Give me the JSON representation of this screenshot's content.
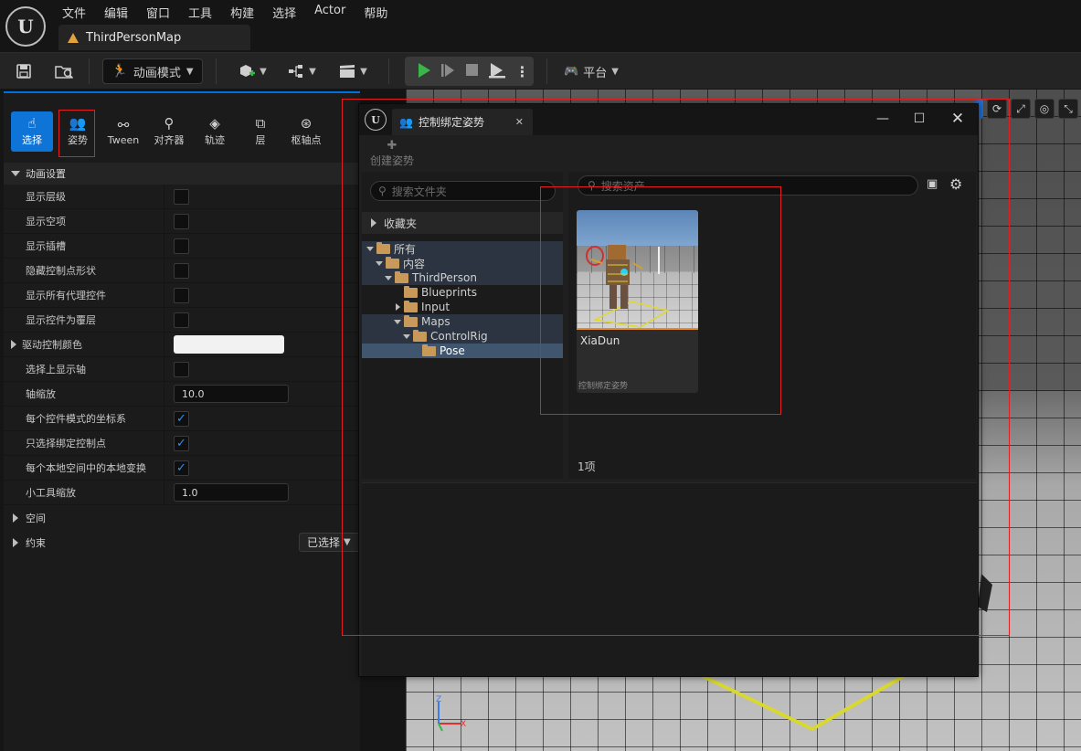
{
  "app": {
    "logo": "U",
    "menu": [
      "文件",
      "编辑",
      "窗口",
      "工具",
      "构建",
      "选择",
      "Actor",
      "帮助"
    ],
    "map_tab": "ThirdPersonMap"
  },
  "toolbar": {
    "mode_label": "动画模式",
    "platform_label": "平台"
  },
  "anim_tools": [
    {
      "label": "选择",
      "icon": "select-icon",
      "active": true
    },
    {
      "label": "姿势",
      "icon": "pose-icon",
      "active": false,
      "highlighted": true
    },
    {
      "label": "Tween",
      "icon": "tween-icon",
      "active": false
    },
    {
      "label": "对齐器",
      "icon": "snapper-icon",
      "active": false
    },
    {
      "label": "轨迹",
      "icon": "trails-icon",
      "active": false
    },
    {
      "label": "层",
      "icon": "layers-icon",
      "active": false
    },
    {
      "label": "枢轴点",
      "icon": "pivot-icon",
      "active": false
    }
  ],
  "settings": {
    "section_title": "动画设置",
    "rows": [
      {
        "label": "显示层级",
        "type": "checkbox",
        "checked": false
      },
      {
        "label": "显示空项",
        "type": "checkbox",
        "checked": false
      },
      {
        "label": "显示插槽",
        "type": "checkbox",
        "checked": false
      },
      {
        "label": "隐藏控制点形状",
        "type": "checkbox",
        "checked": false
      },
      {
        "label": "显示所有代理控件",
        "type": "checkbox",
        "checked": false
      },
      {
        "label": "显示控件为覆层",
        "type": "checkbox",
        "checked": false
      },
      {
        "label": "驱动控制颜色",
        "type": "color",
        "color": "#f2f2f2"
      },
      {
        "label": "选择上显示轴",
        "type": "checkbox",
        "checked": false
      },
      {
        "label": "轴缩放",
        "type": "number",
        "value": "10.0"
      },
      {
        "label": "每个控件模式的坐标系",
        "type": "checkbox",
        "checked": true
      },
      {
        "label": "只选择绑定控制点",
        "type": "checkbox",
        "checked": true
      },
      {
        "label": "每个本地空间中的本地变换",
        "type": "checkbox",
        "checked": true
      },
      {
        "label": "小工具缩放",
        "type": "number",
        "value": "1.0"
      }
    ],
    "space_label": "空间",
    "constraints_label": "约束",
    "constraints_dropdown": "已选择"
  },
  "pose_dialog": {
    "tab_title": "控制绑定姿势",
    "create_pose": "创建姿势",
    "folder_search_placeholder": "搜索文件夹",
    "asset_search_placeholder": "搜索资产",
    "favorites": "收藏夹",
    "tree": {
      "all": "所有",
      "content": "内容",
      "third_person": "ThirdPerson",
      "blueprints": "Blueprints",
      "input": "Input",
      "maps": "Maps",
      "control_rig": "ControlRig",
      "pose": "Pose"
    },
    "asset": {
      "name": "XiaDun",
      "type": "控制绑定姿势"
    },
    "item_count": "1项"
  },
  "colors": {
    "accent": "#0e74d8",
    "highlight_box": "#e02020",
    "folder": "#c9995a",
    "asset_underline": "#e78a2a",
    "play_green": "#3bb54a"
  }
}
